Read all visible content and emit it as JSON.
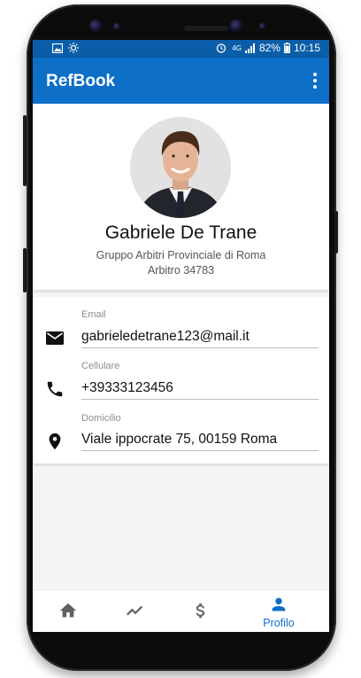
{
  "status_bar": {
    "network": "4G",
    "battery": "82%",
    "time": "10:15"
  },
  "app_bar": {
    "title": "RefBook"
  },
  "profile": {
    "name": "Gabriele De Trane",
    "group": "Gruppo Arbitri Provinciale di Roma",
    "referee_id": "Arbitro 34783"
  },
  "contacts": [
    {
      "label": "Email",
      "value": "gabrieledetrane123@mail.it",
      "icon": "email-icon"
    },
    {
      "label": "Cellulare",
      "value": "+39333123456",
      "icon": "phone-icon"
    },
    {
      "label": "Domicilio",
      "value": "Viale ippocrate 75, 00159 Roma",
      "icon": "location-pin-icon"
    }
  ],
  "bottom_nav": [
    {
      "icon": "home-icon",
      "label": "",
      "active": false
    },
    {
      "icon": "trending-icon",
      "label": "",
      "active": false
    },
    {
      "icon": "dollar-icon",
      "label": "",
      "active": false
    },
    {
      "icon": "person-icon",
      "label": "Profilo",
      "active": true
    }
  ],
  "colors": {
    "primary": "#0d6fc7",
    "primary_dark": "#0a5ea8",
    "background": "#f5f5f5",
    "nav_inactive": "#616161"
  }
}
